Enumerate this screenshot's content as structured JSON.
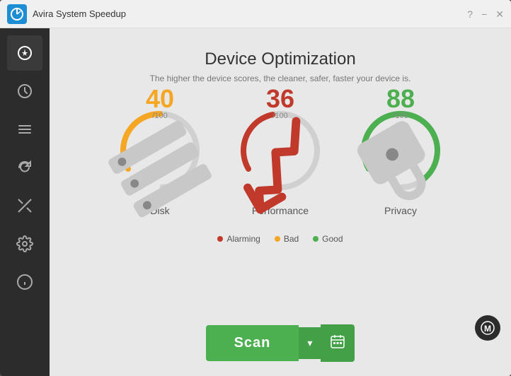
{
  "titlebar": {
    "title": "Avira System Speedup",
    "help_label": "?",
    "minimize_label": "−",
    "close_label": "✕"
  },
  "sidebar": {
    "items": [
      {
        "label": "⏱",
        "name": "dashboard",
        "active": true
      },
      {
        "label": "🕐",
        "name": "history"
      },
      {
        "label": "☰",
        "name": "tasks"
      },
      {
        "label": "⟳",
        "name": "refresh"
      },
      {
        "label": "✂",
        "name": "tools"
      },
      {
        "label": "⚙",
        "name": "settings"
      },
      {
        "label": "ℹ",
        "name": "info"
      }
    ]
  },
  "page": {
    "title": "Device Optimization",
    "subtitle": "The higher the device scores, the cleaner, safer, faster your device is."
  },
  "gauges": [
    {
      "name": "disk",
      "label": "Disk",
      "score": "40",
      "outof": "/100",
      "color": "#f5a623",
      "percent": 40,
      "icon": "💾",
      "icon_color": "#f5a623"
    },
    {
      "name": "performance",
      "label": "Performance",
      "score": "36",
      "outof": "/100",
      "color": "#c0392b",
      "percent": 36,
      "icon": "📈",
      "icon_color": "#c0392b"
    },
    {
      "name": "privacy",
      "label": "Privacy",
      "score": "88",
      "outof": "/100",
      "color": "#4caf50",
      "percent": 88,
      "icon": "🔒",
      "icon_color": "#4caf50"
    }
  ],
  "legend": [
    {
      "label": "Alarming",
      "color": "#c0392b"
    },
    {
      "label": "Bad",
      "color": "#f5a623"
    },
    {
      "label": "Good",
      "color": "#4caf50"
    }
  ],
  "scan_button": {
    "label": "Scan",
    "dropdown_icon": "▾",
    "calendar_icon": "📅"
  },
  "floating_badge": {
    "icon": "Ⓜ"
  }
}
